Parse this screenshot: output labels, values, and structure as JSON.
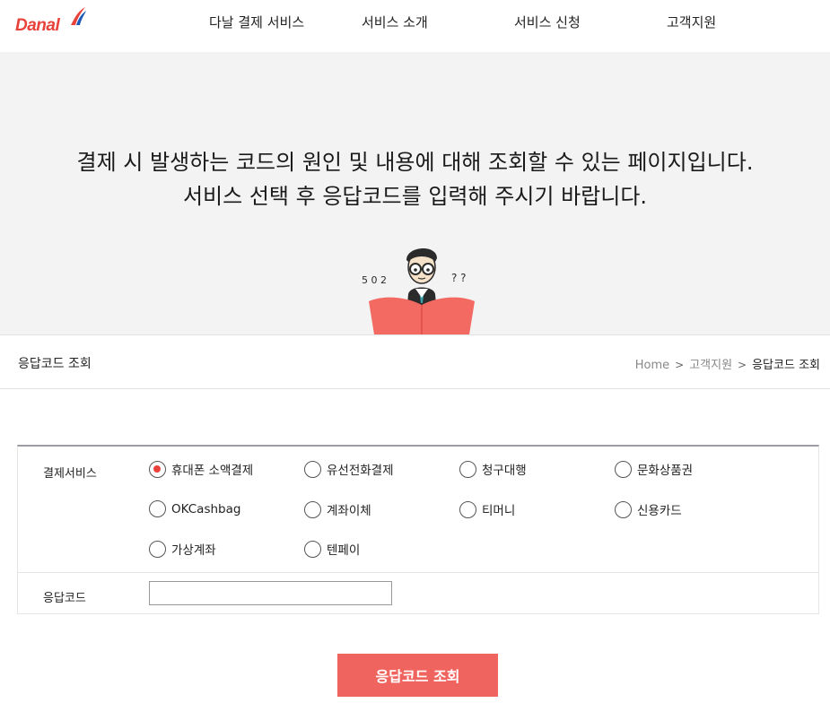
{
  "header": {
    "logo_text": "Danal",
    "nav": [
      {
        "label": "다날 결제 서비스"
      },
      {
        "label": "서비스 소개"
      },
      {
        "label": "서비스 신청"
      },
      {
        "label": "고객지원"
      }
    ]
  },
  "hero": {
    "line1": "결제 시 발생하는 코드의 원인 및 내용에 대해 조회할 수 있는 페이지입니다.",
    "line2": "서비스 선택 후 응답코드를 입력해 주시기 바랍니다.",
    "illustration_left_text": "5 0 2",
    "illustration_right_text": "? ?"
  },
  "subbar": {
    "title": "응답코드 조회",
    "breadcrumb": [
      "Home",
      "고객지원",
      "응답코드 조회"
    ]
  },
  "form": {
    "service_label": "결제서비스",
    "services": [
      {
        "label": "휴대폰 소액결제",
        "checked": true
      },
      {
        "label": "유선전화결제",
        "checked": false
      },
      {
        "label": "청구대행",
        "checked": false
      },
      {
        "label": "문화상품권",
        "checked": false
      },
      {
        "label": "OKCashbag",
        "checked": false
      },
      {
        "label": "계좌이체",
        "checked": false
      },
      {
        "label": "티머니",
        "checked": false
      },
      {
        "label": "신용카드",
        "checked": false
      },
      {
        "label": "가상계좌",
        "checked": false
      },
      {
        "label": "텐페이",
        "checked": false
      }
    ],
    "code_label": "응답코드",
    "code_value": "",
    "code_placeholder": ""
  },
  "submit": {
    "label": "응답코드 조회"
  },
  "colors": {
    "accent": "#f0645f",
    "brand_red": "#e8423a",
    "hero_bg": "#f3f3f3"
  }
}
